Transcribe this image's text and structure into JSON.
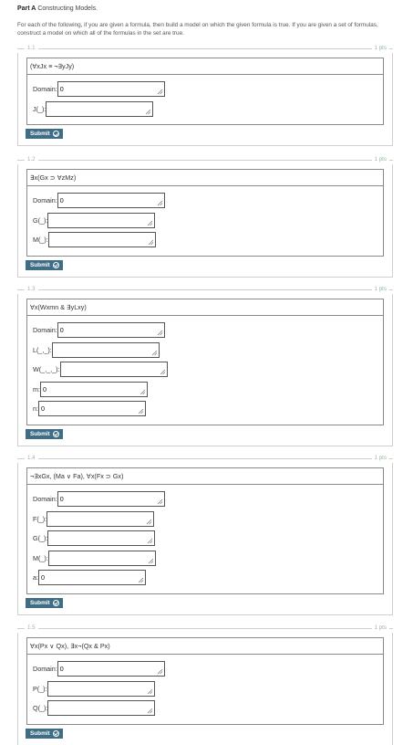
{
  "header": {
    "part_label": "Part A",
    "part_title": "Constructing Models.",
    "instructions": "For each of the following, if you are given a formula, then build a model on which the given formula is true. If you are given a set of formulas, construct a model on which all of the formulas in the set are true."
  },
  "problems": [
    {
      "number": "1.1",
      "points": "1 pts",
      "formula": "(∀xJx ≡ ¬∃yJy)",
      "fields": [
        {
          "label": "Domain:",
          "value": "0"
        },
        {
          "label": "J(_):",
          "value": ""
        }
      ],
      "submit_label": "Submit"
    },
    {
      "number": "1.2",
      "points": "1 pts",
      "formula": "∃x(Gx ⊃ ∀zMz)",
      "fields": [
        {
          "label": "Domain:",
          "value": "0"
        },
        {
          "label": "G(_):",
          "value": ""
        },
        {
          "label": "M(_):",
          "value": ""
        }
      ],
      "submit_label": "Submit"
    },
    {
      "number": "1.3",
      "points": "1 pts",
      "formula": "∀x(Wxmn & ∃yLxy)",
      "fields": [
        {
          "label": "Domain:",
          "value": "0"
        },
        {
          "label": "L(_,_):",
          "value": ""
        },
        {
          "label": "W(_,_,_):",
          "value": ""
        },
        {
          "label": "m:",
          "value": "0"
        },
        {
          "label": "n:",
          "value": "0"
        }
      ],
      "submit_label": "Submit"
    },
    {
      "number": "1.4",
      "points": "1 pts",
      "formula": "¬∃xGx, (Ma ∨ Fa), ∀x(Fx ⊃ Gx)",
      "fields": [
        {
          "label": "Domain:",
          "value": "0"
        },
        {
          "label": "F(_):",
          "value": ""
        },
        {
          "label": "G(_):",
          "value": ""
        },
        {
          "label": "M(_):",
          "value": ""
        },
        {
          "label": "a:",
          "value": "0"
        }
      ],
      "submit_label": "Submit"
    },
    {
      "number": "1.5",
      "points": "1 pts",
      "formula": "∀x(Px ∨ Qx), ∃x¬(Qx & Px)",
      "fields": [
        {
          "label": "Domain:",
          "value": "0"
        },
        {
          "label": "P(_):",
          "value": ""
        },
        {
          "label": "Q(_):",
          "value": ""
        }
      ],
      "submit_label": "Submit"
    }
  ]
}
